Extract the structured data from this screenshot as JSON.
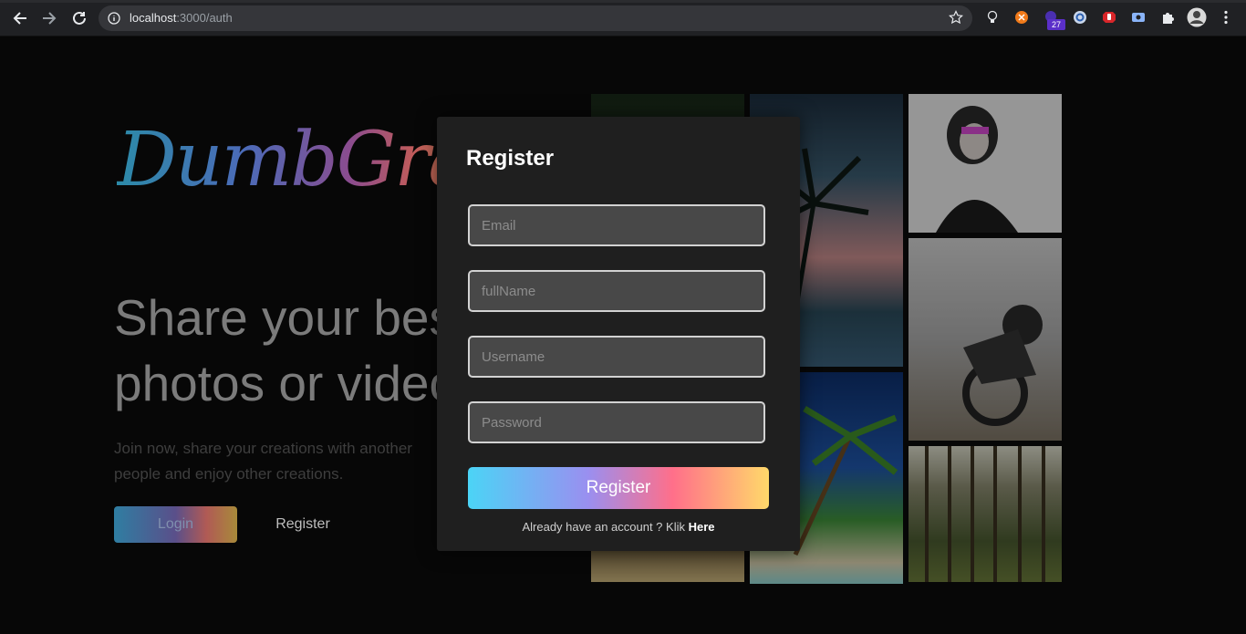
{
  "browser": {
    "url_host": "localhost",
    "url_path": ":3000/auth",
    "extension_badge": "27",
    "icons": [
      "back-arrow-icon",
      "forward-arrow-icon",
      "reload-icon",
      "info-icon",
      "star-icon",
      "lightbulb-extension-icon",
      "orange-extension-icon",
      "purple-extension-icon",
      "blue-circle-extension-icon",
      "red-hand-extension-icon",
      "screen-extension-icon",
      "puzzle-icon",
      "profile-avatar-icon",
      "kebab-menu-icon"
    ]
  },
  "hero": {
    "logo": "DumbGram",
    "headline_line1": "Share your best",
    "headline_line2": "photos or videos",
    "subtext": "Join now, share your creations with another people and enjoy other creations.",
    "login_label": "Login",
    "register_label": "Register"
  },
  "modal": {
    "title": "Register",
    "email_placeholder": "Email",
    "fullname_placeholder": "fullName",
    "username_placeholder": "Username",
    "password_placeholder": "Password",
    "submit_label": "Register",
    "already_text": "Already have an account ? Klik",
    "here_link": "Here"
  },
  "colors": {
    "background": "#070707",
    "modal_bg": "#1f1f1f",
    "input_bg": "#484848",
    "gradient": [
      "#4bd4f6",
      "#9a8ff0",
      "#ff6f8a",
      "#ffd96a"
    ]
  }
}
